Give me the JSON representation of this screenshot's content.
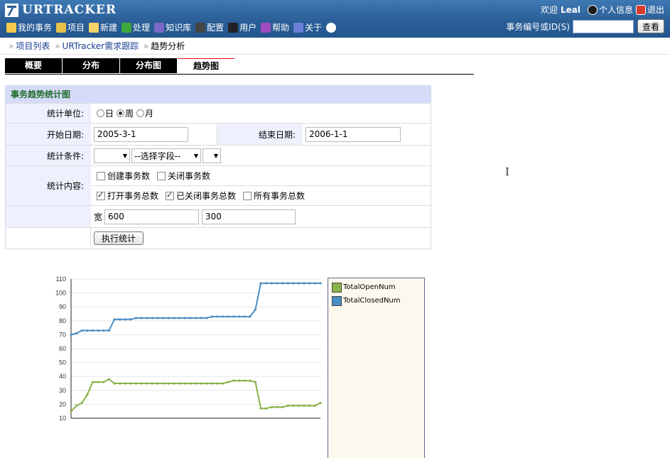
{
  "app": {
    "logo_text": "URTRACKER",
    "welcome_prefix": "欢迎",
    "user_name": "Leal",
    "profile_label": "个人信息",
    "logout_label": "退出"
  },
  "nav": [
    {
      "label": "我的事务",
      "icon": "home-icon",
      "color": "#f2c94c"
    },
    {
      "label": "项目",
      "icon": "folder-icon",
      "color": "#e6c24a"
    },
    {
      "label": "新建",
      "icon": "new-icon",
      "color": "#f6d36a"
    },
    {
      "label": "处理",
      "icon": "check-icon",
      "color": "#3fa83a"
    },
    {
      "label": "知识库",
      "icon": "book-icon",
      "color": "#7b68c8"
    },
    {
      "label": "配置",
      "icon": "config-icon",
      "color": "#444444"
    },
    {
      "label": "用户",
      "icon": "users-icon",
      "color": "#222222"
    },
    {
      "label": "帮助",
      "icon": "help-icon",
      "color": "#a14bc2"
    },
    {
      "label": "关于",
      "icon": "about-icon",
      "color": "#6d7fd6"
    },
    {
      "label": "",
      "icon": "info-icon",
      "color": "#ffffff"
    }
  ],
  "search": {
    "label": "事务编号或ID(S)",
    "value": "",
    "button": "查看"
  },
  "breadcrumb": [
    "项目列表",
    "URTracker需求跟踪",
    "趋势分析"
  ],
  "tabs": [
    {
      "label": "概要",
      "active": false
    },
    {
      "label": "分布",
      "active": false
    },
    {
      "label": "分布图",
      "active": false
    },
    {
      "label": "趋势图",
      "active": true
    }
  ],
  "form": {
    "title": "事务趋势统计图",
    "unit_label": "统计单位:",
    "unit_options": [
      "日",
      "周",
      "月"
    ],
    "unit_selected": "周",
    "start_label": "开始日期:",
    "start_value": "2005-3-1",
    "end_label": "结束日期:",
    "end_value": "2006-1-1",
    "condition_label": "统计条件:",
    "condition_select1": "",
    "condition_select2": "--选择字段--",
    "condition_select3": "",
    "content_label": "统计内容:",
    "checkboxes_row1": [
      {
        "label": "创建事务数",
        "checked": false
      },
      {
        "label": "关闭事务数",
        "checked": false
      }
    ],
    "checkboxes_row2": [
      {
        "label": "打开事务总数",
        "checked": true
      },
      {
        "label": "已关闭事务总数",
        "checked": true
      },
      {
        "label": "所有事务总数",
        "checked": false
      }
    ],
    "width_label": "宽",
    "width_value": "600",
    "height_value": "300",
    "submit_label": "执行统计"
  },
  "chart_data": {
    "type": "line",
    "title": "",
    "xlabel": "",
    "ylabel": "",
    "ylim": [
      10,
      110
    ],
    "yticks": [
      10,
      20,
      30,
      40,
      50,
      60,
      70,
      80,
      90,
      100,
      110
    ],
    "grid": true,
    "legend_position": "right",
    "series": [
      {
        "name": "TotalOpenNum",
        "color": "#8ab34a",
        "values": [
          15,
          19,
          21,
          27,
          36,
          36,
          36,
          38,
          35,
          35,
          35,
          35,
          35,
          35,
          35,
          35,
          35,
          35,
          35,
          35,
          35,
          35,
          35,
          35,
          35,
          35,
          35,
          35,
          35,
          36,
          37,
          37,
          37,
          37,
          36,
          17,
          17,
          18,
          18,
          18,
          19,
          19,
          19,
          19,
          19,
          19,
          21
        ]
      },
      {
        "name": "TotalClosedNum",
        "color": "#4a8ec6",
        "values": [
          70,
          71,
          73,
          73,
          73,
          73,
          73,
          73,
          81,
          81,
          81,
          81,
          82,
          82,
          82,
          82,
          82,
          82,
          82,
          82,
          82,
          82,
          82,
          82,
          82,
          82,
          83,
          83,
          83,
          83,
          83,
          83,
          83,
          83,
          88,
          107,
          107,
          107,
          107,
          107,
          107,
          107,
          107,
          107,
          107,
          107,
          107
        ]
      }
    ]
  }
}
